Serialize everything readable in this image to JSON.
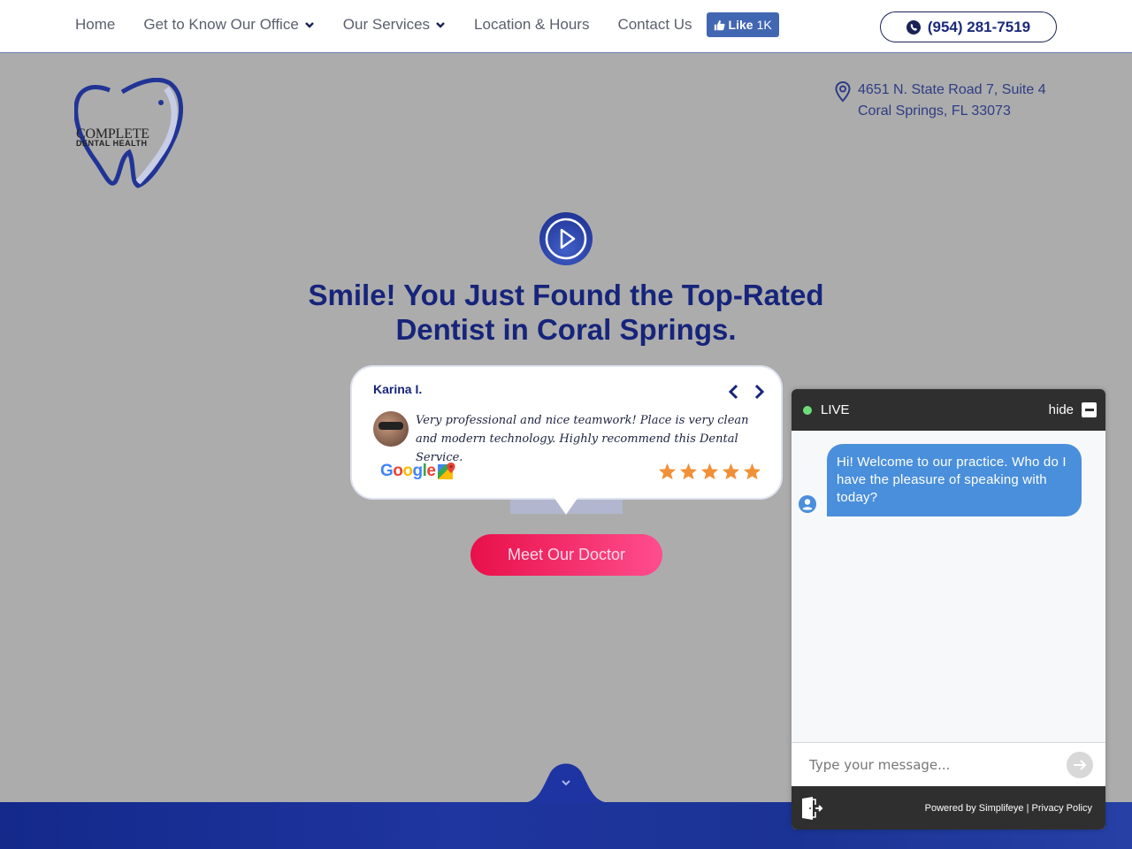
{
  "nav": {
    "items": [
      {
        "label": "Home",
        "has_dropdown": false
      },
      {
        "label": "Get to Know Our Office",
        "has_dropdown": true
      },
      {
        "label": "Our Services",
        "has_dropdown": true
      },
      {
        "label": "Location & Hours",
        "has_dropdown": false
      },
      {
        "label": "Contact Us",
        "has_dropdown": false
      }
    ],
    "fb_like": {
      "label": "Like",
      "count": "1K"
    },
    "phone": "(954) 281-7519"
  },
  "logo": {
    "line1": "COMPLETE",
    "line2": "DENTAL HEALTH"
  },
  "address": {
    "line1": "4651 N. State Road 7, Suite 4",
    "line2": "Coral Springs, FL 33073"
  },
  "hero": {
    "headline": "Smile! You Just Found the Top-Rated Dentist in Coral Springs.",
    "cta_label": "Meet Our Doctor"
  },
  "review": {
    "name": "Karina I.",
    "text": "Very professional and nice teamwork! Place is very clean and modern technology. Highly recommend this Dental Service.",
    "source": "Google",
    "rating": 5,
    "rating_max": 5
  },
  "chat": {
    "status": "LIVE",
    "hide_label": "hide",
    "message": "Hi! Welcome to our practice.  Who do I have the pleasure of speaking with today?",
    "input_placeholder": "Type your message...",
    "input_value": "",
    "powered_by": "Powered by Simplifeye",
    "separator": "|",
    "privacy_label": "Privacy Policy"
  },
  "colors": {
    "brand_navy": "#16247a",
    "cta_pink": "#e8104a",
    "chat_bubble": "#4a8fdb",
    "star_orange": "#f0913a",
    "fb_blue": "#4267b2"
  }
}
